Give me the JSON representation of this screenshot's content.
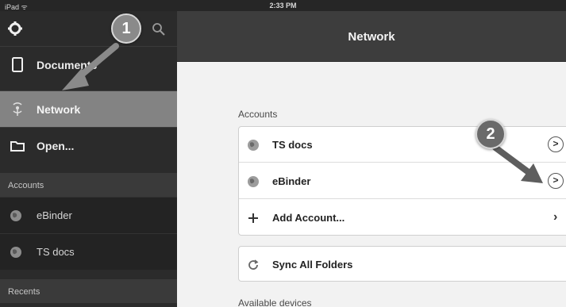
{
  "status_bar": {
    "carrier": "iPad ᯤ",
    "time": "2:33 PM"
  },
  "sidebar": {
    "items": [
      {
        "label": "Documents",
        "icon": "document-icon"
      },
      {
        "label": "Network",
        "icon": "network-icon",
        "active": true
      },
      {
        "label": "Open...",
        "icon": "folder-icon"
      }
    ],
    "accounts_header": "Accounts",
    "accounts": [
      {
        "label": "eBinder",
        "icon": "globe-icon"
      },
      {
        "label": "TS docs",
        "icon": "globe-icon"
      }
    ],
    "recents_header": "Recents"
  },
  "navbar": {
    "title": "Network"
  },
  "main": {
    "accounts_label": "Accounts",
    "accounts": [
      {
        "label": "TS docs",
        "icon": "globe-icon",
        "accessory": "detail-disclosure"
      },
      {
        "label": "eBinder",
        "icon": "globe-icon",
        "accessory": "detail-disclosure"
      }
    ],
    "add_account_label": "Add Account...",
    "sync_label": "Sync All Folders",
    "available_devices_label": "Available devices"
  },
  "callouts": {
    "one": "1",
    "two": "2"
  },
  "colors": {
    "sidebar_bg": "#2b2b2b",
    "active_item_bg": "#838383",
    "navbar_bg": "#3d3d3d",
    "content_bg": "#f2f2f2",
    "callout_bg": "#8a8a8a"
  }
}
